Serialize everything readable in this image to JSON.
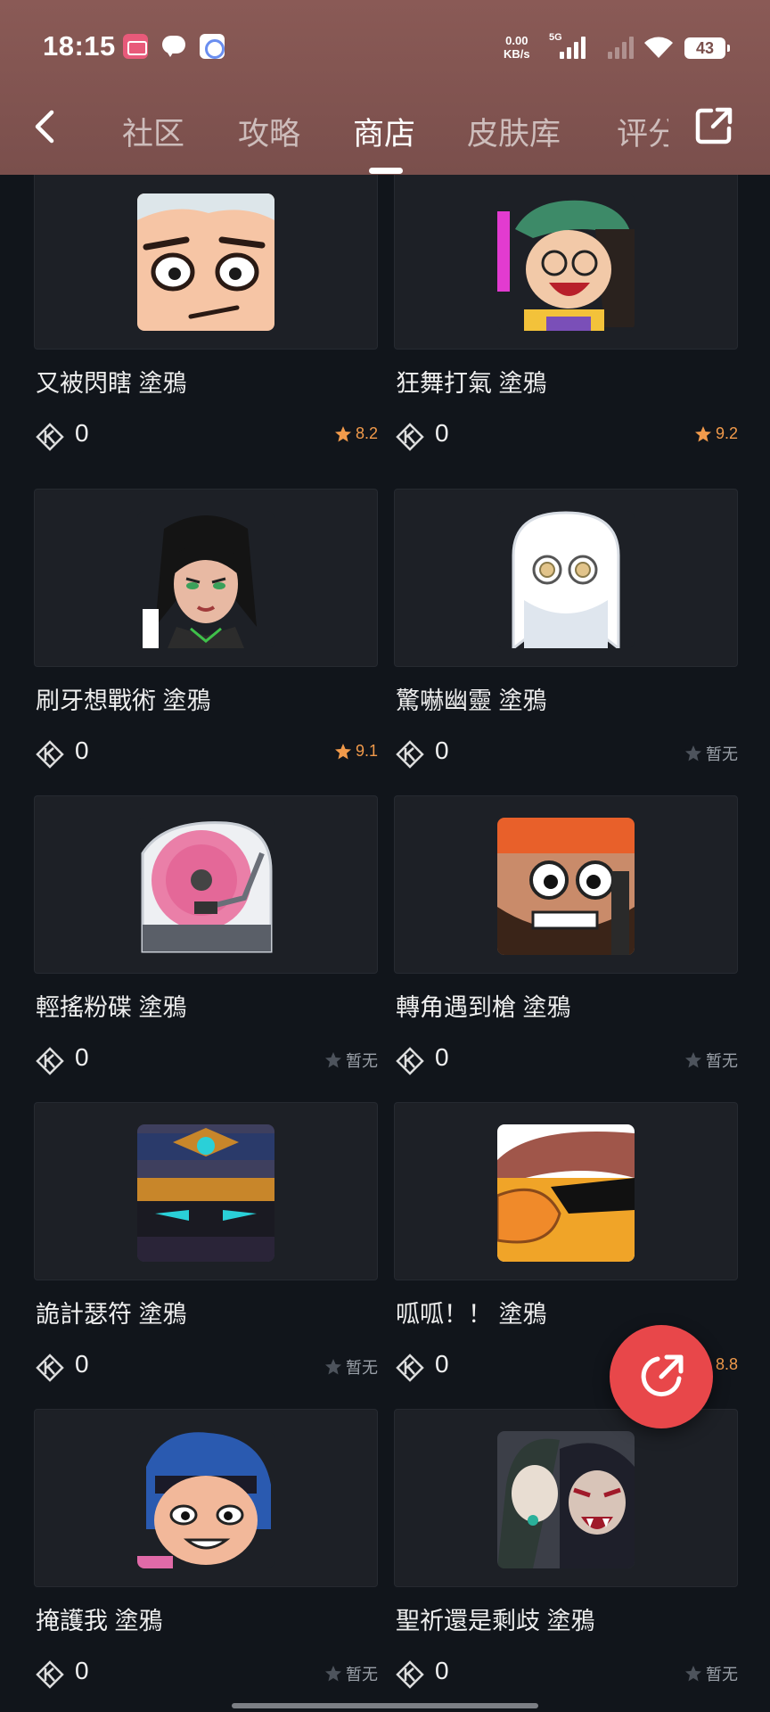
{
  "status_bar": {
    "time": "18:15",
    "net_speed_top": "0.00",
    "net_speed_bottom": "KB/s",
    "network_type": "5G",
    "battery": "43"
  },
  "nav": {
    "tabs": [
      {
        "label": "社区"
      },
      {
        "label": "攻略"
      },
      {
        "label": "商店",
        "active": true
      },
      {
        "label": "皮肤库"
      },
      {
        "label": "评分"
      }
    ]
  },
  "colors": {
    "header": "#7a4f4c",
    "background": "#11151b",
    "card": "#1d2026",
    "rating_star": "#f19a4b",
    "fab": "#e8474a"
  },
  "items": [
    {
      "name": "又被閃瞎 塗鴉",
      "price": "0",
      "rating": "8.2",
      "rated": true,
      "art": "face-flashed"
    },
    {
      "name": "狂舞打氣 塗鴉",
      "price": "0",
      "rating": "9.2",
      "rated": true,
      "art": "dancer"
    },
    {
      "name": "刷牙想戰術 塗鴉",
      "price": "0",
      "rating": "9.1",
      "rated": true,
      "art": "viper"
    },
    {
      "name": "驚嚇幽靈 塗鴉",
      "price": "0",
      "rating": "暂无",
      "rated": false,
      "art": "ghost"
    },
    {
      "name": "輕搖粉碟 塗鴉",
      "price": "0",
      "rating": "暂无",
      "rated": false,
      "art": "turntable"
    },
    {
      "name": "轉角遇到槍 塗鴉",
      "price": "0",
      "rating": "暂无",
      "rated": false,
      "art": "bearded"
    },
    {
      "name": "詭計瑟符 塗鴉",
      "price": "0",
      "rating": "暂无",
      "rated": false,
      "art": "robot"
    },
    {
      "name": "呱呱！！ 塗鴉",
      "price": "0",
      "rating": "8.8",
      "rated": true,
      "art": "duck"
    },
    {
      "name": "掩護我 塗鴉",
      "price": "0",
      "rating": "暂无",
      "rated": false,
      "art": "girl"
    },
    {
      "name": "聖祈還是剩歧 塗鴉",
      "price": "0",
      "rating": "暂无",
      "rated": false,
      "art": "vampire"
    }
  ]
}
